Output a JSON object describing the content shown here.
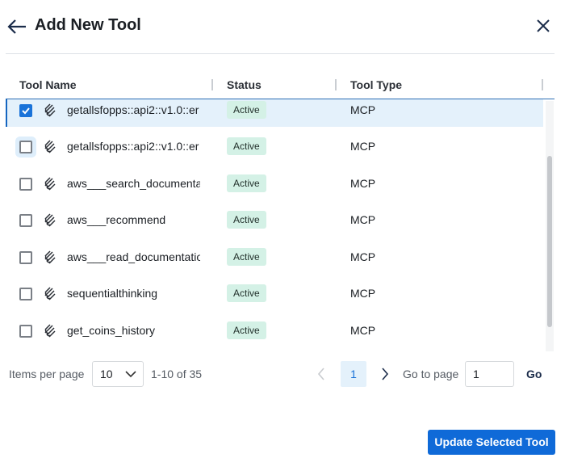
{
  "header": {
    "title": "Add New Tool"
  },
  "table": {
    "columns": [
      "Tool Name",
      "Status",
      "Tool Type"
    ],
    "rows": [
      {
        "name": "getallsfopps::api2::v1.0::er",
        "status": "Active",
        "type": "MCP",
        "checked": true
      },
      {
        "name": "getallsfopps::api2::v1.0::er",
        "status": "Active",
        "type": "MCP",
        "checked": false
      },
      {
        "name": "aws___search_documentation",
        "status": "Active",
        "type": "MCP",
        "checked": false
      },
      {
        "name": "aws___recommend",
        "status": "Active",
        "type": "MCP",
        "checked": false
      },
      {
        "name": "aws___read_documentation",
        "status": "Active",
        "type": "MCP",
        "checked": false
      },
      {
        "name": "sequentialthinking",
        "status": "Active",
        "type": "MCP",
        "checked": false
      },
      {
        "name": "get_coins_history",
        "status": "Active",
        "type": "MCP",
        "checked": false
      }
    ]
  },
  "pagination": {
    "items_per_page_label": "Items per page",
    "items_per_page": "10",
    "range": "1-10 of 35",
    "current_page": "1",
    "go_to_label": "Go to page",
    "go_to_value": "1",
    "go_label": "Go"
  },
  "footer": {
    "update_label": "Update Selected Tool"
  },
  "colors": {
    "accent": "#0f6ad8",
    "badge_bg": "#d4f1e6",
    "selected_row": "#e4f1fb"
  }
}
